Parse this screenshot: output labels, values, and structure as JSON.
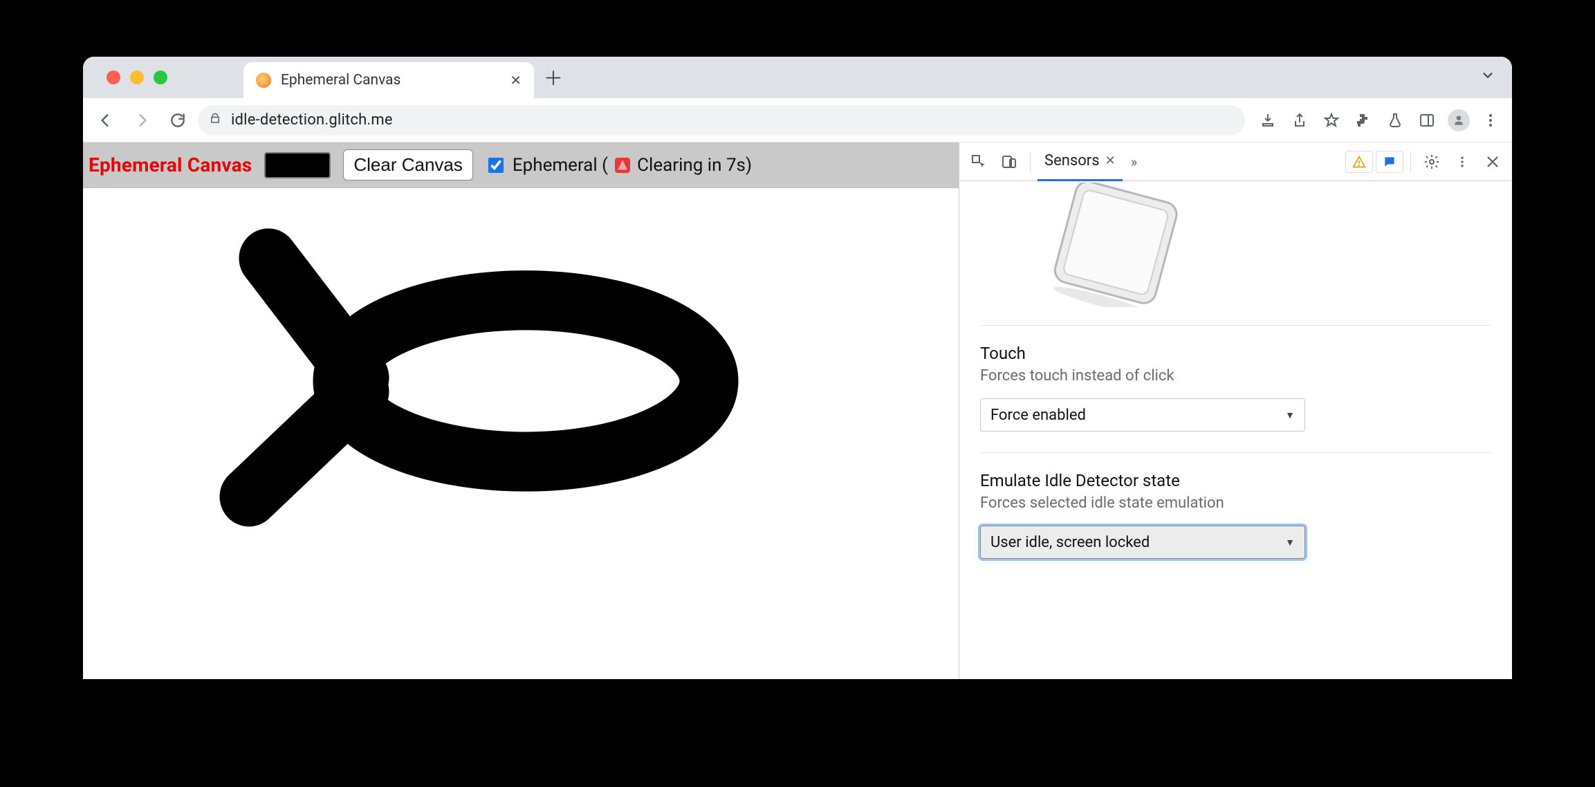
{
  "browser": {
    "tab_title": "Ephemeral Canvas",
    "url": "idle-detection.glitch.me"
  },
  "page": {
    "title": "Ephemeral Canvas",
    "color_hex": "#000000",
    "clear_button": "Clear Canvas",
    "ephemeral_checked": true,
    "ephemeral_label_prefix": "Ephemeral (",
    "ephemeral_label_suffix": "Clearing in 7s)"
  },
  "devtools": {
    "active_tab": "Sensors",
    "touch": {
      "title": "Touch",
      "subtitle": "Forces touch instead of click",
      "value": "Force enabled"
    },
    "idle": {
      "title": "Emulate Idle Detector state",
      "subtitle": "Forces selected idle state emulation",
      "value": "User idle, screen locked"
    }
  }
}
